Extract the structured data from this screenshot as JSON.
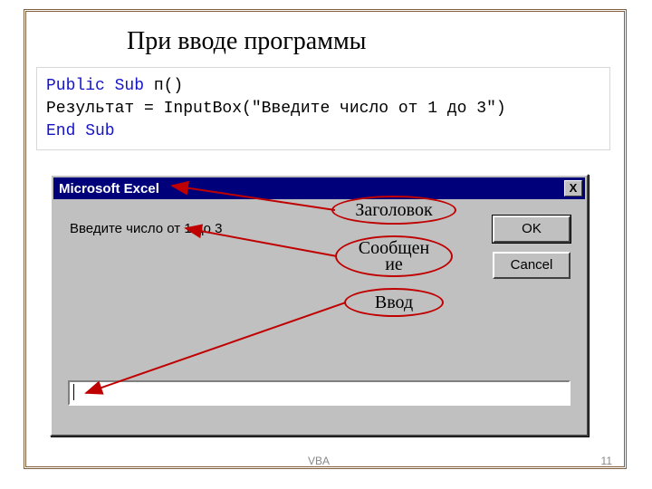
{
  "heading": "При вводе программы",
  "code": {
    "line1_kw1": "Public Sub",
    "line1_rest": " п()",
    "line2": "Результат = InputBox(\"Введите число от 1 до 3\")",
    "line3_kw": "End Sub"
  },
  "dialog": {
    "title": "Microsoft Excel",
    "close": "X",
    "prompt": "Введите число от 1 до 3",
    "ok": "OK",
    "cancel": "Cancel",
    "input_value": ""
  },
  "callouts": {
    "title": "Заголовок",
    "message": "Сообщен\nие",
    "input": "Ввод"
  },
  "footer": {
    "label": "VBA",
    "page": "11"
  },
  "colors": {
    "accent_red": "#c00000",
    "titlebar_blue": "#00007b",
    "win_gray": "#c0c0c0",
    "frame_brown": "#806040"
  }
}
